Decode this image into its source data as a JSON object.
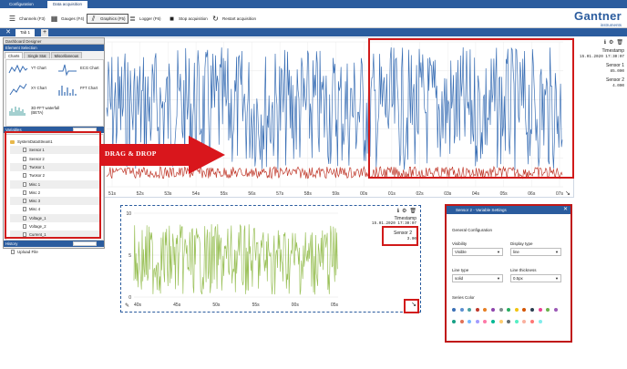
{
  "top_tabs": [
    {
      "label": "Configuration",
      "active": false
    },
    {
      "label": "Data acquisition",
      "active": true
    }
  ],
  "toolbar": {
    "channels": "Channels (F3)",
    "gauges": "Gauges (F4)",
    "graphics": "Graphics (F5)",
    "logger": "Logger (F6)",
    "stop": "Stop acquisition",
    "restart": "Restart acquisition"
  },
  "brand": {
    "name": "Gantner",
    "sub": "instruments"
  },
  "tabstrip": {
    "tab_label": "Tab 1"
  },
  "designer": {
    "title": "Dashboard Designer",
    "element_selection": "Element Selection",
    "tabs": [
      "Charts",
      "Single Stat",
      "Miscellaneous"
    ],
    "chart_types": [
      "YT Chart",
      "ECG Chart",
      "XY Chart",
      "FFT Chart",
      "3D-FFT waterfall (BETA)"
    ],
    "variables_head": "Variables",
    "variables": [
      {
        "label": "SystemDataStream1",
        "kind": "folder"
      },
      {
        "label": "Sensor 1",
        "kind": "item"
      },
      {
        "label": "Sensor 2",
        "kind": "item"
      },
      {
        "label": "Twosor 1",
        "kind": "item"
      },
      {
        "label": "Twosor 2",
        "kind": "item"
      },
      {
        "label": "Misc 1",
        "kind": "item"
      },
      {
        "label": "Misc 2",
        "kind": "item"
      },
      {
        "label": "Misc 3",
        "kind": "item"
      },
      {
        "label": "Misc 4",
        "kind": "item"
      },
      {
        "label": "Voltage_1",
        "kind": "item"
      },
      {
        "label": "Voltage_2",
        "kind": "item"
      },
      {
        "label": "Current_1",
        "kind": "item"
      }
    ],
    "history_head": "History",
    "upload": "Upload File"
  },
  "drag_text": "DRAG & DROP",
  "top_chart": {
    "timestamp_label": "Timestamp",
    "timestamp_value": "15.01.2020 17:30:07",
    "sensors": [
      {
        "name": "Sensor 1",
        "value": "85.000",
        "color": "#3a6fb5"
      },
      {
        "name": "Sensor 2",
        "value": "4.000",
        "color": "#c0392b"
      }
    ],
    "x_ticks": [
      "51s",
      "52s",
      "53s",
      "54s",
      "55s",
      "56s",
      "57s",
      "58s",
      "59s",
      "00s",
      "01s",
      "02s",
      "03s",
      "04s",
      "05s",
      "06s",
      "07s"
    ]
  },
  "bottom_chart": {
    "timestamp_label": "Timestamp",
    "timestamp_value": "15.01.2020 17:30:07",
    "sensor_name": "Sensor 2",
    "sensor_value": "3.00",
    "y_ticks": [
      "10",
      "5",
      "0"
    ],
    "x_ticks": [
      "40s",
      "45s",
      "50s",
      "55s",
      "00s",
      "05s"
    ]
  },
  "settings": {
    "title": "Sensor 2 - Variable Settings",
    "general": "General Configuration",
    "visibility_label": "Visibility",
    "visibility_value": "Visible",
    "display_type_label": "Display type",
    "display_type_value": "line",
    "line_type_label": "Line type",
    "line_type_value": "solid",
    "line_thickness_label": "Line thickness",
    "line_thickness_value": "0.5px",
    "series_color_label": "Series Color",
    "palette": [
      "#3a6fb5",
      "#5b8fd0",
      "#4aa0a0",
      "#c0392b",
      "#e67e22",
      "#8e44ad",
      "#7f8c8d",
      "#27ae60",
      "#f1c40f",
      "#d35400",
      "#2c3e50",
      "#e84393",
      "#6ab04c",
      "#9b59b6",
      "#16a085",
      "#e17055",
      "#74b9ff",
      "#a29bfe",
      "#fd79a8",
      "#00b894",
      "#fdcb6e",
      "#636e72",
      "#55efc4",
      "#fab1a0",
      "#ff7675",
      "#81ecec"
    ]
  },
  "colors": {
    "brand_blue": "#2b5c9e",
    "series_blue": "#3a6fb5",
    "series_red": "#c0392b",
    "series_green": "#9bc15a",
    "highlight_red": "#d11a1a"
  }
}
